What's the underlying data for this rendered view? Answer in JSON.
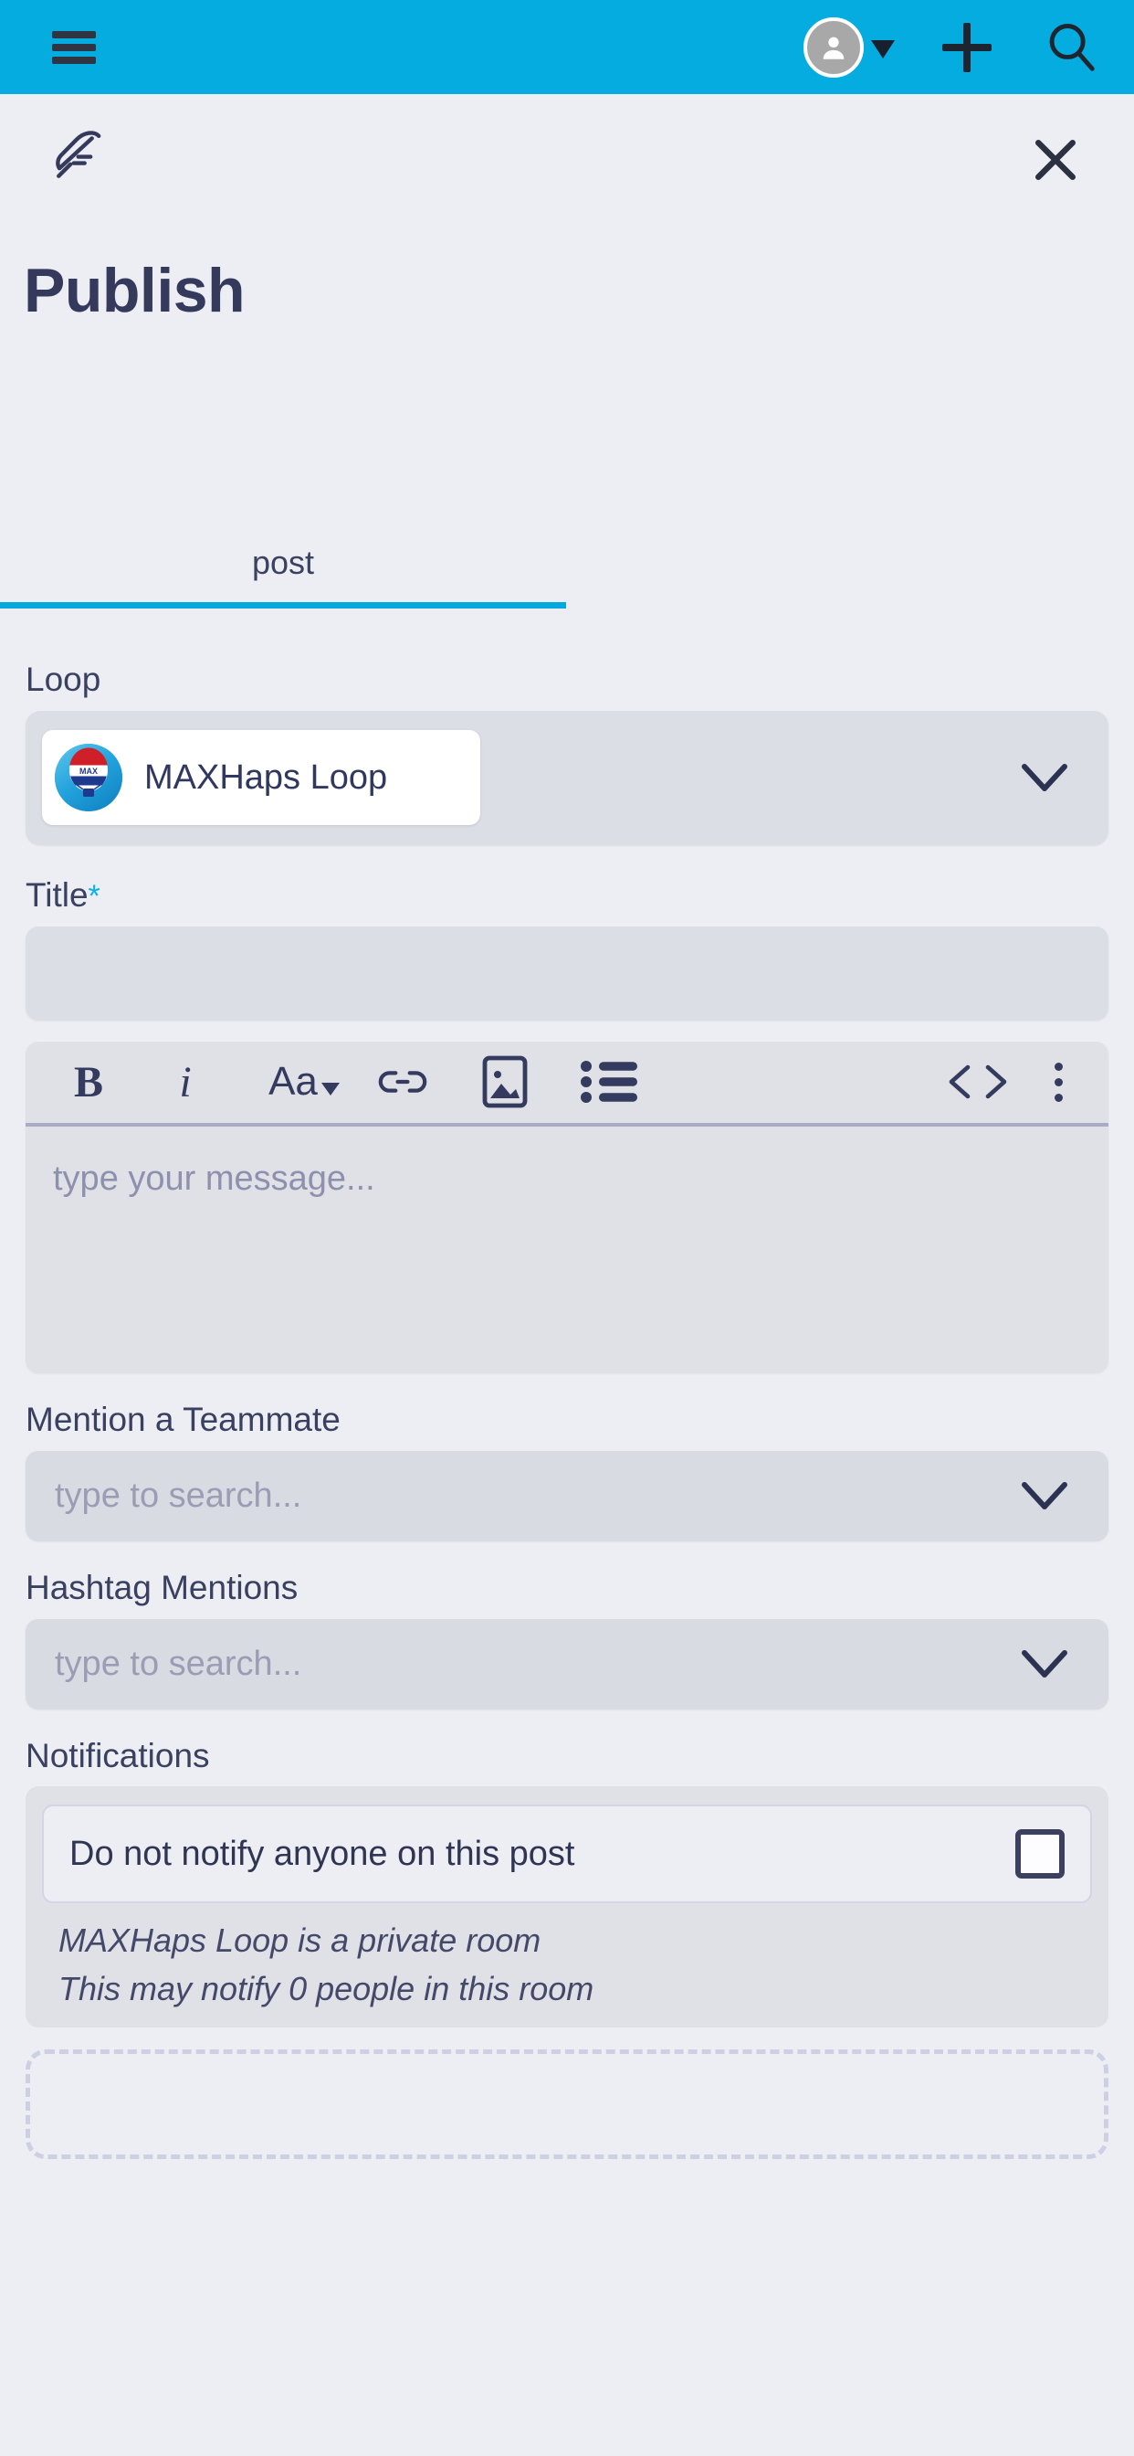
{
  "appbar": {
    "menu_icon": "hamburger-menu-icon",
    "avatar_icon": "user-avatar-icon",
    "caret_icon": "caret-down-icon",
    "add_icon": "plus-icon",
    "search_icon": "search-icon",
    "background_color": "#04ace0"
  },
  "panel": {
    "brand_icon": "feather-icon",
    "close_icon": "close-x-icon",
    "title": "Publish"
  },
  "tabs": {
    "items": [
      {
        "label": "post",
        "active": true
      }
    ],
    "active_color": "#05a8dc"
  },
  "form": {
    "loop": {
      "label": "Loop",
      "selected": "MAXHaps Loop",
      "avatar_icon": "hot-air-balloon-logo",
      "chevron_icon": "chevron-down-icon"
    },
    "title": {
      "label": "Title",
      "required_mark": "*",
      "value": "",
      "placeholder": "",
      "required_color": "#09b0e6"
    },
    "editor": {
      "toolbar": [
        {
          "name": "bold",
          "label": "B"
        },
        {
          "name": "italic",
          "label": "i"
        },
        {
          "name": "font-size",
          "label": "Aa"
        },
        {
          "name": "link",
          "label": ""
        },
        {
          "name": "image",
          "label": ""
        },
        {
          "name": "bullet-list",
          "label": ""
        },
        {
          "name": "code",
          "label": "<>"
        },
        {
          "name": "more-options",
          "label": ""
        }
      ],
      "placeholder": "type your message...",
      "value": ""
    },
    "mention": {
      "label": "Mention a Teammate",
      "placeholder": "type to search...",
      "value": "",
      "chevron_icon": "chevron-down-icon"
    },
    "hashtag": {
      "label": "Hashtag Mentions",
      "placeholder": "type to search...",
      "value": "",
      "chevron_icon": "chevron-down-icon"
    },
    "notifications": {
      "label": "Notifications",
      "option_label": "Do not notify anyone on this post",
      "checked": false,
      "note_line_1": "MAXHaps Loop is a private room",
      "note_line_2": "This may notify 0 people in this room"
    }
  }
}
